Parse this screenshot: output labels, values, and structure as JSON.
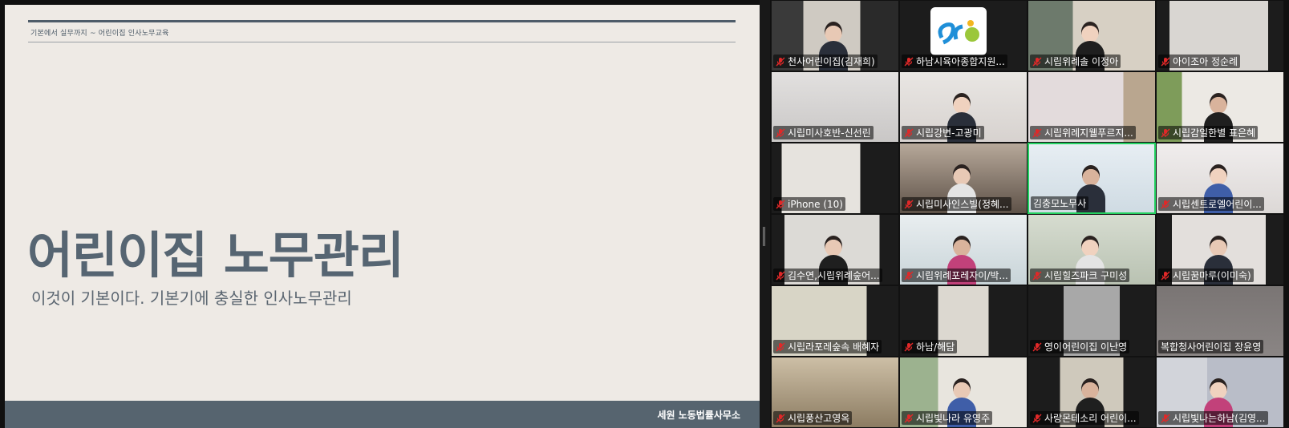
{
  "slide": {
    "header": "기본에서 실무까지 ~ 어린이집 인사노무교육",
    "title": "어린이집 노무관리",
    "subtitle": "이것이 기본이다. 기본기에 충실한 인사노무관리",
    "footer": "세원 노동법률사무소"
  },
  "gallery": {
    "participants": [
      {
        "name": "천사어린이집(김재희)",
        "muted": true,
        "active": false
      },
      {
        "name": "하남시육아종합지원...",
        "muted": true,
        "active": false
      },
      {
        "name": "시립위례솔 이정아",
        "muted": true,
        "active": false
      },
      {
        "name": "아이조아 정순례",
        "muted": true,
        "active": false
      },
      {
        "name": "시립미사호반-신선린",
        "muted": true,
        "active": false
      },
      {
        "name": "시립강변-고광미",
        "muted": true,
        "active": false
      },
      {
        "name": "시립위례지웰푸르지...",
        "muted": true,
        "active": false
      },
      {
        "name": "시립감일한별 표은혜",
        "muted": true,
        "active": false
      },
      {
        "name": "iPhone (10)",
        "muted": true,
        "active": false
      },
      {
        "name": "시립미사인스빌(정혜...",
        "muted": true,
        "active": false
      },
      {
        "name": "김충모노무사",
        "muted": false,
        "active": true
      },
      {
        "name": "시립센트로엘어린이...",
        "muted": true,
        "active": false
      },
      {
        "name": "김수연,시립위례숲어...",
        "muted": true,
        "active": false
      },
      {
        "name": "시립위례포레자이/박...",
        "muted": true,
        "active": false
      },
      {
        "name": "시립힐즈파크 구미성",
        "muted": true,
        "active": false
      },
      {
        "name": "시립꿈마루(이미숙)",
        "muted": true,
        "active": false
      },
      {
        "name": "시립라포레숲속 배혜자",
        "muted": true,
        "active": false
      },
      {
        "name": "하남/해담",
        "muted": true,
        "active": false
      },
      {
        "name": "영이어린이집 이난영",
        "muted": true,
        "active": false
      },
      {
        "name": "복합청사어린이집 장윤영",
        "muted": false,
        "active": false
      },
      {
        "name": "시립풍산고영옥",
        "muted": true,
        "active": false
      },
      {
        "name": "시립빛나라 유영주",
        "muted": true,
        "active": false
      },
      {
        "name": "사랑몬테소리 어린이...",
        "muted": true,
        "active": false
      },
      {
        "name": "시립빛나는하남(김영...",
        "muted": true,
        "active": false
      }
    ]
  },
  "colors": {
    "slide_bg": "#eeeae5",
    "slide_accent": "#56646f",
    "active_speaker": "#23d160",
    "mute_red": "#e02828"
  }
}
